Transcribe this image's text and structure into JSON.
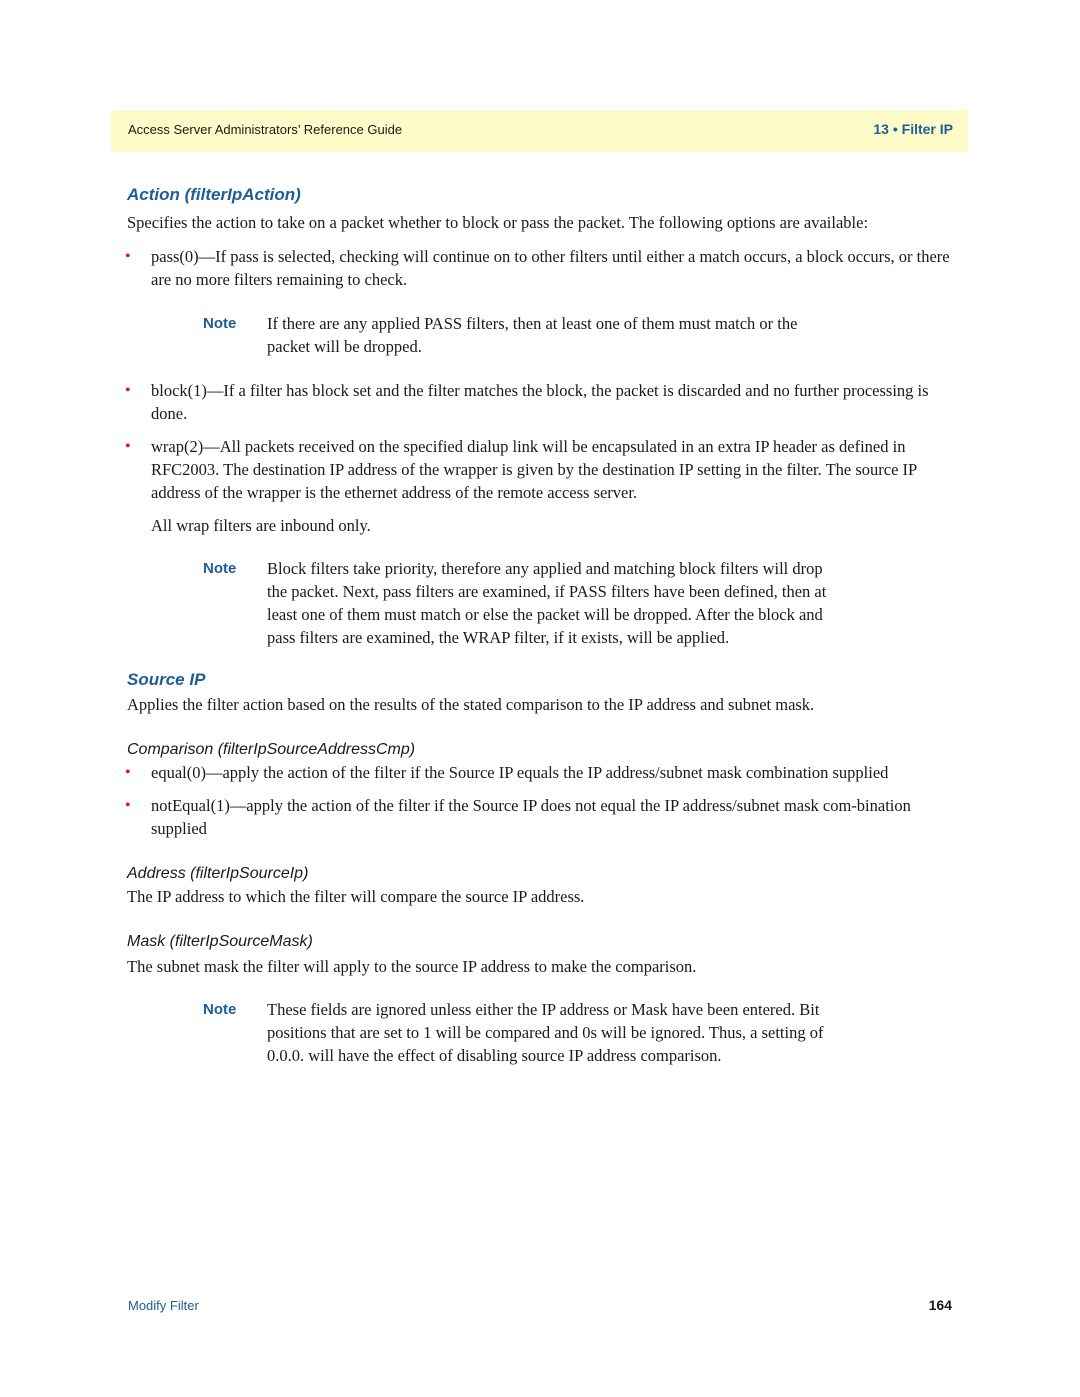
{
  "header": {
    "guide_title": "Access Server Administrators’ Reference Guide",
    "chapter": "13 • Filter IP"
  },
  "action_section": {
    "heading": "Action (filterIpAction)",
    "intro": "Specifies the action to take on a packet whether to block or pass the packet. The following options are available:",
    "options": [
      {
        "text": "pass(0)—If pass is selected, checking will continue on to other filters until either a match occurs, a block occurs, or there are no more filters remaining to check."
      },
      {
        "text": "block(1)—If a filter has block set and the filter matches the block, the packet is discarded and no further processing is done."
      },
      {
        "text": "wrap(2)—All packets received on the specified dialup link will be encapsulated in an extra IP header as defined in RFC2003. The destination IP address of the wrapper is given by the destination IP setting in the filter. The source IP address of the wrapper is the ethernet address of the remote access server."
      }
    ],
    "note1": {
      "label": "Note",
      "text": "If there are any applied PASS filters, then at least one of them must match or the packet will be dropped."
    },
    "wrap_followup": "All wrap filters are inbound only.",
    "note2": {
      "label": "Note",
      "text": "Block filters take priority, therefore any applied and matching block filters will drop the packet. Next, pass filters are examined, if PASS filters have been defined, then at least one of them must match or else the packet will be dropped. After the block and pass filters are examined, the WRAP filter, if it exists, will be applied."
    }
  },
  "source_ip_section": {
    "heading": "Source IP",
    "intro": "Applies the filter action based on the results of the stated comparison to the IP address and subnet mask.",
    "comparison": {
      "heading": "Comparison (filterIpSourceAddressCmp)",
      "options": [
        {
          "text": "equal(0)—apply the action of the filter if the Source IP equals the IP address/subnet mask combination supplied"
        },
        {
          "text": "notEqual(1)—apply the action of the filter if the Source IP does not equal the IP address/subnet mask com-bination supplied"
        }
      ]
    },
    "address": {
      "heading": "Address (filterIpSourceIp)",
      "text": "The IP address to which the filter will compare the source IP address."
    },
    "mask": {
      "heading": "Mask (filterIpSourceMask)",
      "text": "The subnet mask the filter will apply to the source IP address to make the comparison."
    },
    "note": {
      "label": "Note",
      "text": "These fields are ignored unless either the IP address or Mask have been entered. Bit positions that are set to 1 will be compared and 0s will be ignored. Thus, a setting of 0.0.0. will have the effect of disabling source IP address comparison."
    }
  },
  "footer": {
    "section_name": "Modify Filter",
    "page_number": "164"
  },
  "colors": {
    "accent_blue": "#1f5d96",
    "header_band": "#fdfcc8",
    "bullet_red": "#e0141e"
  }
}
